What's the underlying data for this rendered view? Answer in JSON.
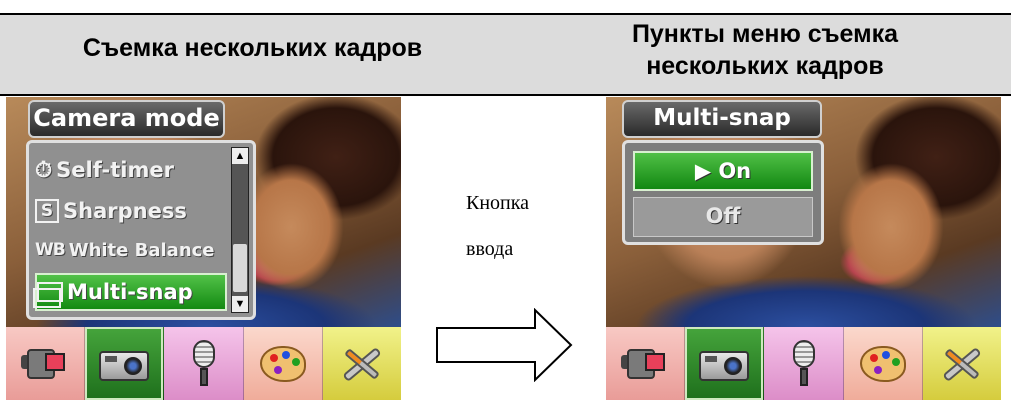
{
  "header": {
    "left_title": "Съемка нескольких кадров",
    "right_title_line1": "Пункты меню съемка",
    "right_title_line2": "нескольких кадров"
  },
  "middle": {
    "line1": "Кнопка",
    "line2": "ввода"
  },
  "left_screen": {
    "menu_title": "Camera mode",
    "items": [
      {
        "icon": "self-timer-icon",
        "label": "Self-timer",
        "selected": false
      },
      {
        "icon": "sharpness-icon",
        "label": "Sharpness",
        "icon_text": "S",
        "selected": false
      },
      {
        "icon": "white-balance-icon",
        "label": "White Balance",
        "icon_text": "WB",
        "selected": false
      },
      {
        "icon": "multi-snap-icon",
        "label": "Multi-snap",
        "selected": true
      }
    ]
  },
  "right_screen": {
    "menu_title": "Multi-snap",
    "options": [
      {
        "label": "On",
        "selected": true
      },
      {
        "label": "Off",
        "selected": false
      }
    ]
  },
  "toolbar": {
    "tabs": [
      {
        "icon": "video-camera-icon",
        "color": "#e99c98"
      },
      {
        "icon": "camera-icon",
        "color": "#1e6f1c"
      },
      {
        "icon": "microphone-icon",
        "color": "#dc8dc8"
      },
      {
        "icon": "palette-icon",
        "color": "#f0ac9a"
      },
      {
        "icon": "tools-icon",
        "color": "#d5cc3d"
      }
    ],
    "active_tab": "camera-icon"
  },
  "colors": {
    "selection_green": "#1e9a1a",
    "menu_grey": "#8a8a8a",
    "header_grey": "#dcdcdc"
  }
}
